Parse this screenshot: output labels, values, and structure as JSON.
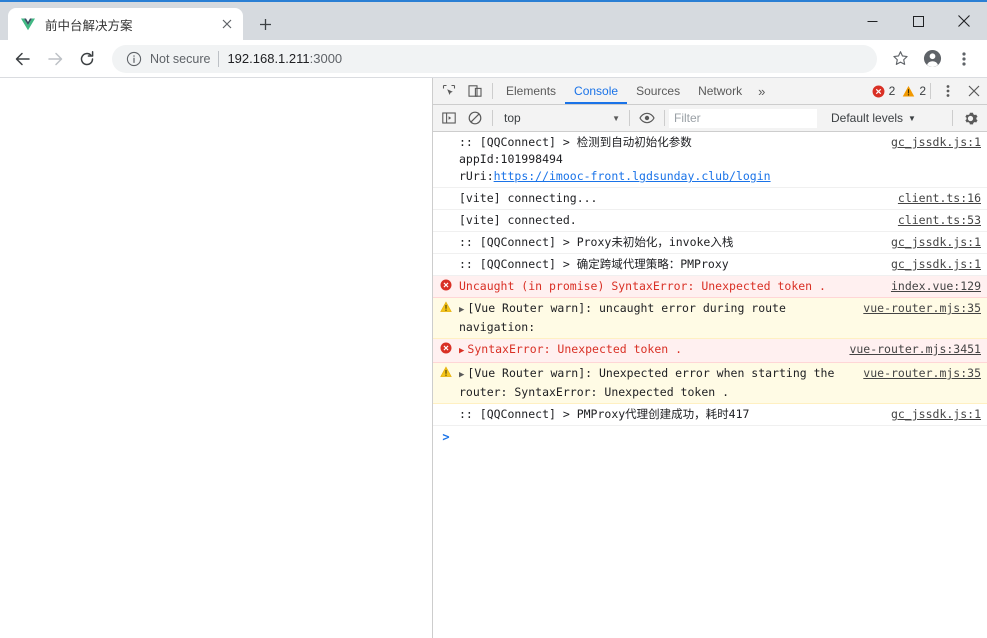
{
  "window": {
    "minimize_label": "minimize",
    "maximize_label": "maximize",
    "close_label": "close"
  },
  "tabstrip": {
    "tab_title": "前中台解决方案",
    "tab_close_label": "✕",
    "new_tab_label": "+",
    "favicon": "vue-logo-icon"
  },
  "toolbar": {
    "back_label": "back-icon",
    "forward_label": "forward-icon",
    "reload_label": "reload-icon",
    "security_text": "Not secure",
    "url_host": "192.168.1.211",
    "url_port": ":3000",
    "url_full": "192.168.1.211:3000",
    "bookmark_label": "star-icon",
    "profile_label": "profile-icon",
    "menu_label": "three-dot-menu-icon"
  },
  "devtools": {
    "tabs": [
      {
        "label": "Elements",
        "active": false
      },
      {
        "label": "Console",
        "active": true
      },
      {
        "label": "Sources",
        "active": false
      },
      {
        "label": "Network",
        "active": false
      }
    ],
    "more_tabs_label": "»",
    "error_count": "2",
    "warning_count": "2",
    "panel_menu_label": "⋮",
    "panel_close_label": "✕",
    "filterbar": {
      "context": "top",
      "context_caret": "▼",
      "filter_placeholder": "Filter",
      "filter_value": "",
      "levels_label": "Default levels",
      "levels_caret": "▼",
      "settings_label": "gear-icon"
    },
    "console": {
      "prompt_caret": ">",
      "messages": [
        {
          "level": "info",
          "lines": [
            ":: [QQConnect] > 检测到自动初始化参数",
            "appId:101998494"
          ],
          "url_prefix": "rUri:",
          "url": "https://imooc-front.lgdsunday.club/login",
          "source": "gc_jssdk.js:1",
          "indent": true
        },
        {
          "level": "info",
          "lines": [
            "[vite] connecting..."
          ],
          "source": "client.ts:16",
          "indent": false
        },
        {
          "level": "info",
          "lines": [
            "[vite] connected."
          ],
          "source": "client.ts:53",
          "indent": false
        },
        {
          "level": "info",
          "lines": [
            ":: [QQConnect] > Proxy未初始化，invoke入栈"
          ],
          "source": "gc_jssdk.js:1",
          "indent": true
        },
        {
          "level": "info",
          "lines": [
            ":: [QQConnect] > 确定跨域代理策略：PMProxy"
          ],
          "source": "gc_jssdk.js:1",
          "indent": true
        },
        {
          "level": "error",
          "lines": [
            "Uncaught (in promise) SyntaxError: Unexpected token ."
          ],
          "source": "index.vue:129",
          "expandable": false
        },
        {
          "level": "warn",
          "lines": [
            "[Vue Router warn]: uncaught error during route navigation:"
          ],
          "source": "vue-router.mjs:35",
          "expandable": true
        },
        {
          "level": "error",
          "lines": [
            "SyntaxError: Unexpected token ."
          ],
          "source": "vue-router.mjs:3451",
          "expandable": true
        },
        {
          "level": "warn",
          "lines": [
            "[Vue Router warn]: Unexpected error when starting the router: SyntaxError: Unexpected token ."
          ],
          "source": "vue-router.mjs:35",
          "expandable": true
        },
        {
          "level": "info",
          "lines": [
            ":: [QQConnect] > PMProxy代理创建成功，耗时417"
          ],
          "source": "gc_jssdk.js:1",
          "indent": true
        }
      ]
    }
  },
  "colors": {
    "accent": "#1a73e8",
    "error": "#d93025",
    "warning": "#f29900",
    "titlebar": "#d6dadf",
    "error_row_bg": "#fff0f0",
    "warn_row_bg": "#fffbe5"
  }
}
